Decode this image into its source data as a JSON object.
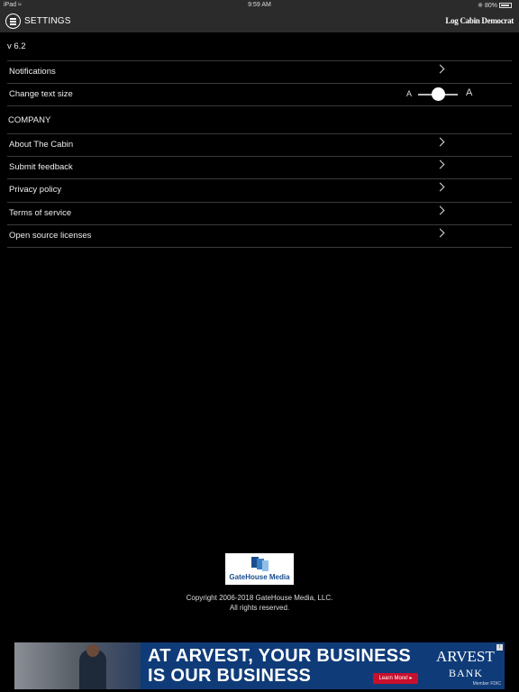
{
  "status_bar": {
    "device": "iPad",
    "time": "9:59 AM",
    "battery": "80%"
  },
  "nav": {
    "title": "SETTINGS",
    "brand": "Log Cabin Democrat"
  },
  "version": "v 6.2",
  "settings": {
    "notifications": "Notifications",
    "text_size": {
      "label": "Change text size",
      "small_a": "A",
      "large_a": "A",
      "level": 0.5
    }
  },
  "company": {
    "title": "COMPANY",
    "items": [
      "About The Cabin",
      "Submit feedback",
      "Privacy policy",
      "Terms of service",
      "Open source licenses"
    ]
  },
  "footer": {
    "logo_text": "GateHouse Media",
    "copyright_line1": "Copyright 2006-2018 GateHouse Media, LLC.",
    "copyright_line2": "All rights reserved."
  },
  "ad": {
    "headline_line1": "AT ARVEST, YOUR BUSINESS",
    "headline_line2": "IS OUR BUSINESS",
    "cta": "Learn More! ▸",
    "bank_name": "ARVEST",
    "bank_sub": "BANK",
    "member": "Member FDIC"
  }
}
